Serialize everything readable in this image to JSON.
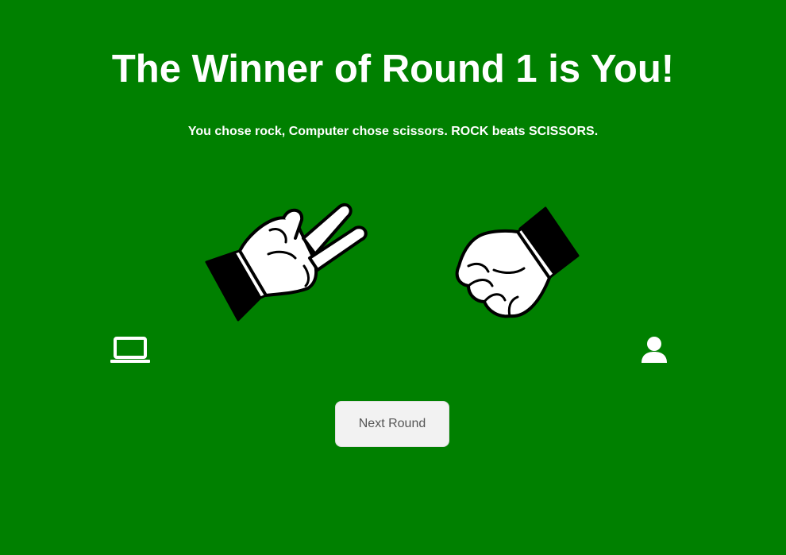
{
  "result": {
    "title": "The Winner of Round 1 is You!",
    "message": "You chose rock, Computer chose scissors. ROCK beats SCISSORS."
  },
  "computer": {
    "choice": "scissors",
    "hand_icon": "scissors-hand-icon",
    "avatar_icon": "laptop-icon"
  },
  "player": {
    "choice": "rock",
    "hand_icon": "fist-hand-icon",
    "avatar_icon": "person-icon"
  },
  "controls": {
    "next_round_label": "Next Round"
  },
  "colors": {
    "background": "#008000",
    "text": "#ffffff",
    "button_bg": "#f2f2f2",
    "button_text": "#555555"
  }
}
